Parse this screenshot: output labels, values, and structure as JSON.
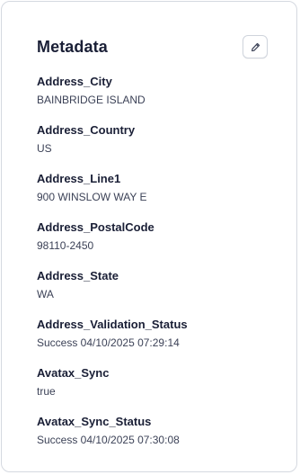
{
  "card": {
    "title": "Metadata",
    "edit_icon": "pencil-icon"
  },
  "fields": [
    {
      "key": "Address_City",
      "value": "BAINBRIDGE ISLAND"
    },
    {
      "key": "Address_Country",
      "value": "US"
    },
    {
      "key": "Address_Line1",
      "value": "900 WINSLOW WAY E"
    },
    {
      "key": "Address_PostalCode",
      "value": "98110-2450"
    },
    {
      "key": "Address_State",
      "value": "WA"
    },
    {
      "key": "Address_Validation_Status",
      "value": "Success 04/10/2025 07:29:14"
    },
    {
      "key": "Avatax_Sync",
      "value": "true"
    },
    {
      "key": "Avatax_Sync_Status",
      "value": "Success 04/10/2025 07:30:08"
    }
  ]
}
